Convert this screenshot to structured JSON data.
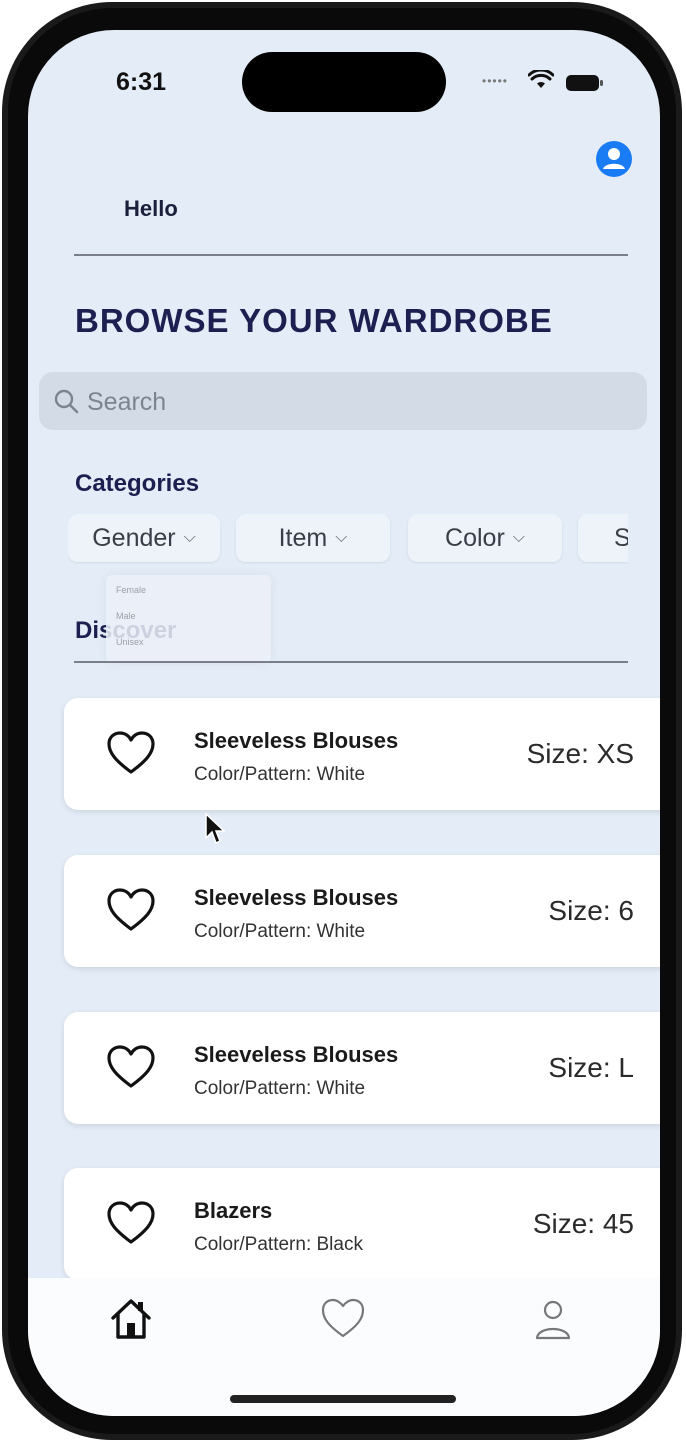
{
  "status_bar": {
    "time": "6:31"
  },
  "header": {
    "greeting": "Hello",
    "title": "BROWSE YOUR WARDROBE"
  },
  "search": {
    "placeholder": "Search"
  },
  "categories": {
    "title": "Categories",
    "filters": [
      {
        "label": "Gender"
      },
      {
        "label": "Item"
      },
      {
        "label": "Color"
      },
      {
        "label": "S"
      }
    ],
    "dropdown_options": [
      "Female",
      "Male",
      "Unisex"
    ]
  },
  "discover": {
    "title": "Discover"
  },
  "items": [
    {
      "name": "Sleeveless Blouses",
      "color": "Color/Pattern: White",
      "size": "Size: XS"
    },
    {
      "name": "Sleeveless Blouses",
      "color": "Color/Pattern: White",
      "size": "Size: 6"
    },
    {
      "name": "Sleeveless Blouses",
      "color": "Color/Pattern: White",
      "size": "Size: L"
    },
    {
      "name": "Blazers",
      "color": "Color/Pattern: Black",
      "size": "Size: 45"
    }
  ],
  "tab_bar": {
    "icons": [
      "home-icon",
      "heart-icon",
      "person-icon"
    ]
  },
  "colors": {
    "background": "#e3ecf7",
    "title": "#1c1f4f",
    "accent": "#1a7cf5",
    "card": "#ffffff"
  }
}
